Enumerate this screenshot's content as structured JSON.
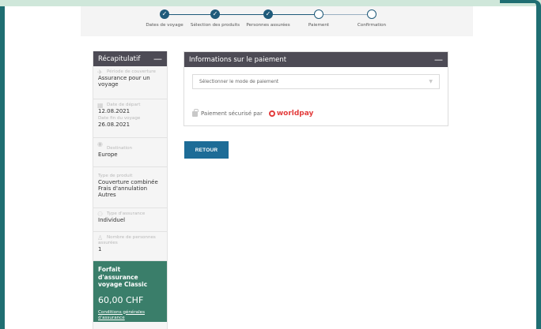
{
  "stepper": {
    "steps": [
      {
        "label": "Dates de voyage",
        "state": "done"
      },
      {
        "label": "Sélection des produits",
        "state": "done"
      },
      {
        "label": "Personnes assurées",
        "state": "done"
      },
      {
        "label": "Paiement",
        "state": "current"
      },
      {
        "label": "Confirmation",
        "state": "pending"
      }
    ],
    "check_glyph": "✓"
  },
  "sidebar": {
    "title": "Récapitulatif",
    "collapse_glyph": "—",
    "sections": {
      "coverage": {
        "label": "Période de couverture",
        "value": "Assurance pour un voyage"
      },
      "dates": {
        "start_label": "Date de départ",
        "start_value": "12.08.2021",
        "end_label": "Date fin du voyage",
        "end_value": "26.08.2021"
      },
      "destination": {
        "label": "Destination",
        "value": "Europe"
      },
      "product": {
        "label": "Type de produit",
        "value": "Couverture combinée Frais d'annulation Autres"
      },
      "insurance_type": {
        "label": "Type d'assurance",
        "value": "Individuel"
      },
      "persons": {
        "label": "Nombre de personnes assurées",
        "value": "1"
      }
    },
    "price": {
      "name": "Forfait d'assurance voyage Classic",
      "amount": "60,00 CHF",
      "link": "Conditions générales d'assurance"
    }
  },
  "payment": {
    "title": "Informations sur le paiement",
    "collapse_glyph": "—",
    "select_placeholder": "Sélectionner le mode de paiement",
    "secure_text": "Paiement sécurisé par",
    "provider": "worldpay"
  },
  "actions": {
    "back_label": "RETOUR"
  },
  "colors": {
    "accent": "#1f5a7a",
    "header_bg": "#4d4b55",
    "price_bg": "#3a7e6a",
    "button_bg": "#1d6c97",
    "worldpay_red": "#e33c3c"
  }
}
